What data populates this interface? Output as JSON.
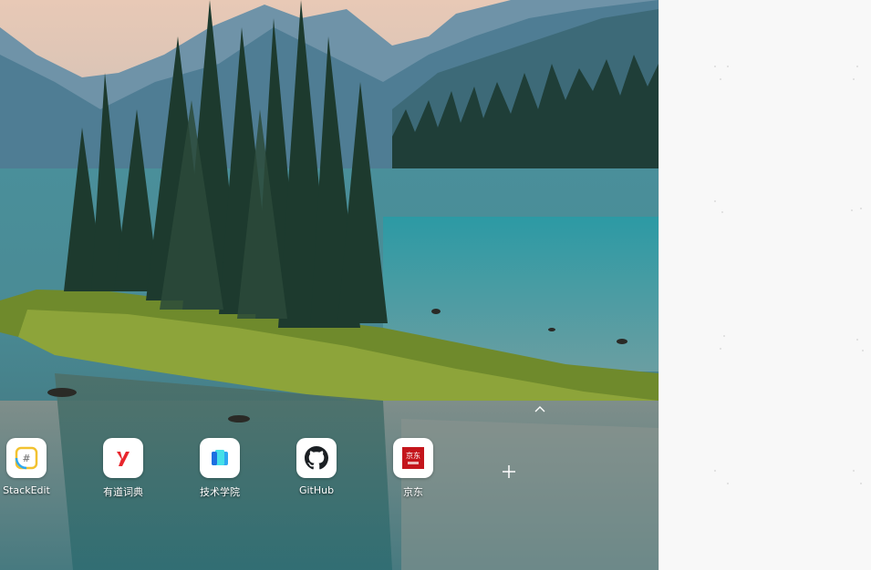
{
  "shortcuts": [
    {
      "label": "StackEdit",
      "icon": "stackedit-icon"
    },
    {
      "label": "有道词典",
      "icon": "youdao-icon"
    },
    {
      "label": "技术学院",
      "icon": "tech-academy-icon"
    },
    {
      "label": "GitHub",
      "icon": "github-icon"
    },
    {
      "label": "京东",
      "icon": "jd-icon"
    }
  ],
  "jd_logo_text": "京东",
  "add_icon": "plus-icon",
  "collapse_icon": "chevron-up-icon",
  "colors": {
    "stackedit": "#f2c230",
    "youdao": "#e8262d",
    "tech_academy": "#2fa8f0",
    "github": "#1b1f23",
    "jd": "#c4151c"
  }
}
